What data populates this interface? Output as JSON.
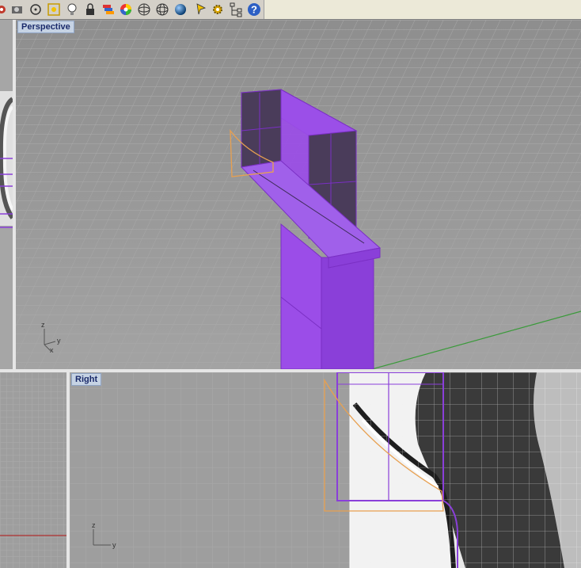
{
  "toolbar": {
    "icons": [
      "curve-tool-icon",
      "camera-icon",
      "circle-point-icon",
      "snap-icon",
      "lightbulb-icon",
      "lock-icon",
      "color-layers-icon",
      "color-wheel-icon",
      "sphere-wire-icon",
      "mesh-icon",
      "render-sphere-icon",
      "pointer-flag-icon",
      "gear-icon",
      "hierarchy-icon",
      "help-icon"
    ],
    "help_glyph": "?"
  },
  "viewports": {
    "perspective": {
      "label": "Perspective",
      "axis_z": "z",
      "axis_y": "y",
      "axis_x": "x"
    },
    "right": {
      "label": "Right",
      "axis_z": "z",
      "axis_y": "y"
    }
  },
  "colors": {
    "selection": "#8a3fd9",
    "selection_fill": "#9b4de8",
    "curve": "#e8a050",
    "grid_bg": "#9a9a9a",
    "x_axis": "#b03030",
    "y_axis": "#3a9a3a"
  }
}
